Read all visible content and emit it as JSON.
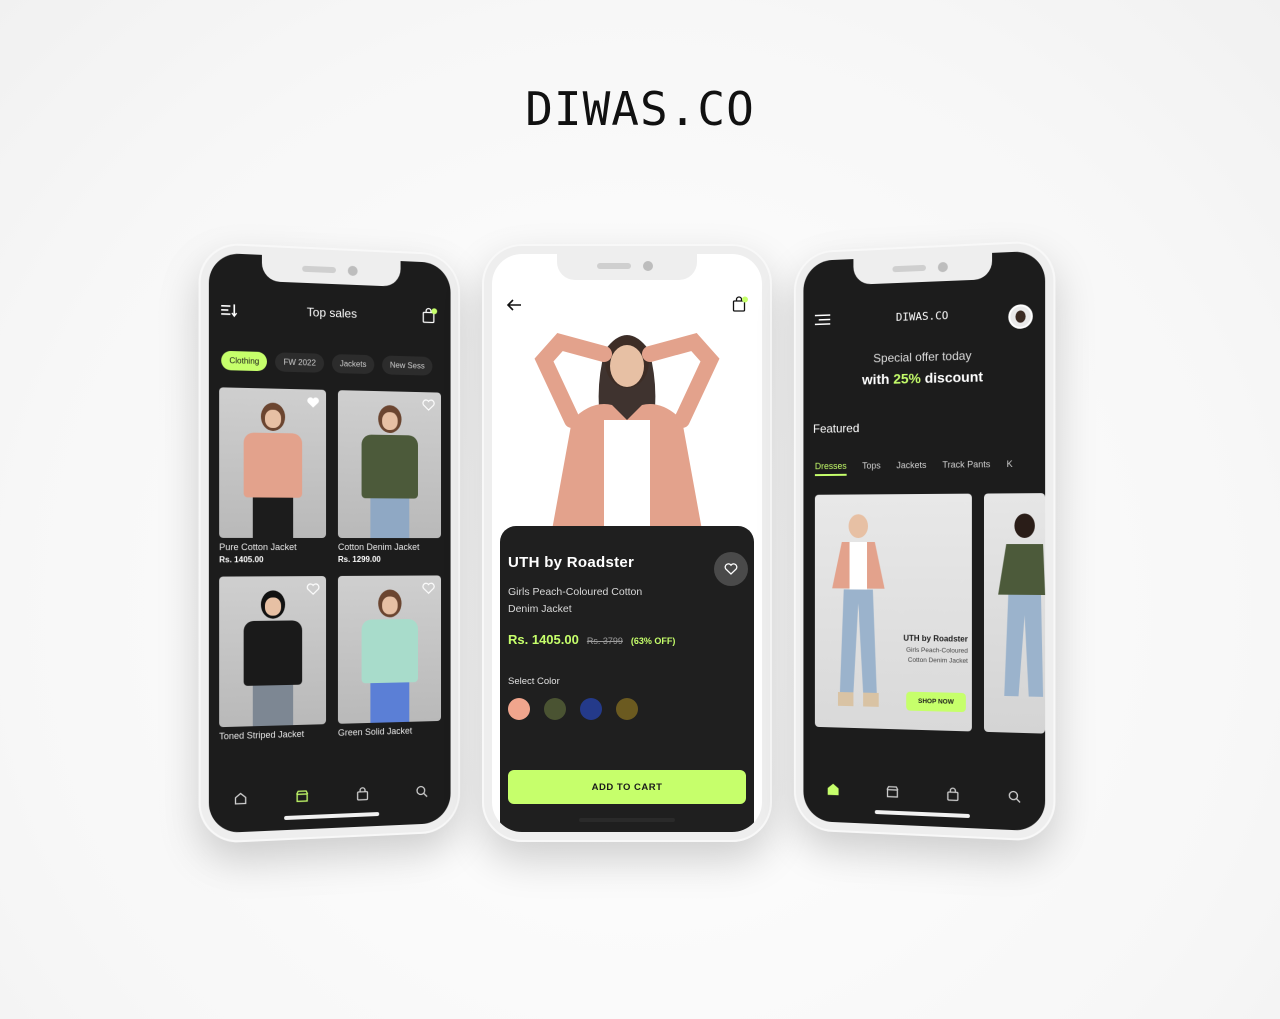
{
  "brand": "DIWAS.CO",
  "colors": {
    "accent": "#c6ff6b",
    "dark": "#1c1c1c"
  },
  "phone1": {
    "title": "Top sales",
    "bag_badge": "1",
    "chips": [
      "Clothing",
      "FW 2022",
      "Jackets",
      "New Sess"
    ],
    "products": [
      {
        "name": "Pure Cotton Jacket",
        "price": "Rs. 1405.00",
        "color": "#e3a28c"
      },
      {
        "name": "Cotton Denim Jacket",
        "price": "Rs. 1299.00",
        "color": "#4c5a3a"
      },
      {
        "name": "Toned Striped Jacket",
        "price": "",
        "color": "#1a1a1a"
      },
      {
        "name": "Green Solid  Jacket",
        "price": "",
        "color": "#a8dccb"
      }
    ],
    "nav": [
      "home-icon",
      "store-icon",
      "bag-icon",
      "search-icon"
    ]
  },
  "phone2": {
    "product_title": "UTH by Roadster",
    "description": "Girls Peach-Coloured Cotton Denim Jacket",
    "price_now": "Rs. 1405.00",
    "price_old": "Rs. 3799",
    "discount": "(63% OFF)",
    "select_color": "Select Color",
    "colors": [
      "#f0a58d",
      "#4a5332",
      "#243a8a",
      "#6b5a20"
    ],
    "cta": "ADD TO CART"
  },
  "phone3": {
    "logo": "DIWAS.CO",
    "offer_line1": "Special offer today",
    "offer_prefix": "with ",
    "offer_value": "25%",
    "offer_suffix": " discount",
    "featured": "Featured",
    "tabs": [
      "Dresses",
      "Tops",
      "Jackets",
      "Track Pants",
      "K"
    ],
    "banner_title": "UTH by Roadster",
    "banner_desc": "Girls Peach-Coloured Cotton Denim Jacket",
    "shop_now": "SHOP NOW",
    "nav": [
      "home-icon",
      "store-icon",
      "bag-icon",
      "search-icon"
    ]
  }
}
